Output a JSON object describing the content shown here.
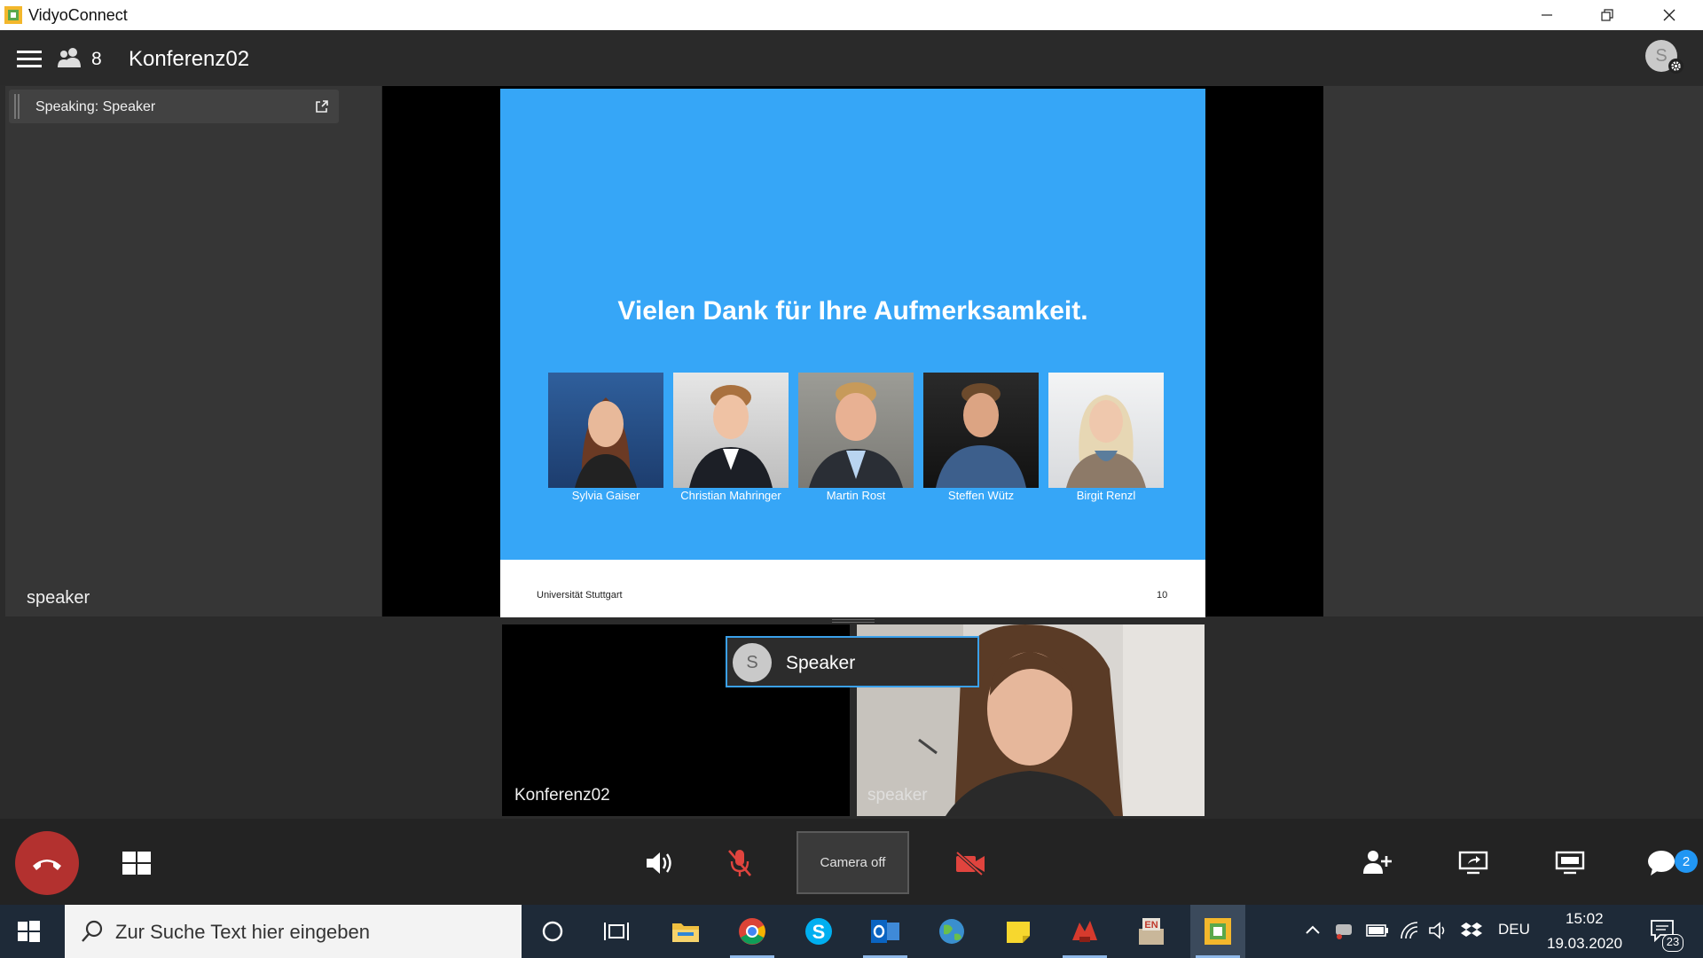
{
  "window": {
    "title": "VidyoConnect"
  },
  "header": {
    "participant_count": "8",
    "conference_name": "Konferenz02",
    "avatar_initial": "S"
  },
  "left_panel": {
    "speaking_label": "Speaking: Speaker",
    "speaker_name": "speaker"
  },
  "slide": {
    "title": "Vielen Dank für Ihre Aufmerksamkeit.",
    "people": [
      "Sylvia Gaiser",
      "Christian Mahringer",
      "Martin Rost",
      "Steffen Wütz",
      "Birgit Renzl"
    ],
    "footer_left": "Universität Stuttgart",
    "page_number": "10",
    "colors": {
      "background": "#36a6f7"
    }
  },
  "tiles": {
    "conference_label": "Konferenz02",
    "speaker_label": "speaker",
    "popup": {
      "initial": "S",
      "name": "Speaker"
    }
  },
  "controls": {
    "camera_label": "Camera off",
    "chat_badge": "2"
  },
  "taskbar": {
    "search_placeholder": "Zur Suche Text hier eingeben",
    "language": "DEU",
    "time": "15:02",
    "date": "19.03.2020",
    "notification_count": "23"
  },
  "icons": [
    "menu-icon",
    "participants-icon",
    "settings-icon",
    "popout-icon",
    "hangup-icon",
    "layout-icon",
    "speaker-icon",
    "mic-muted-icon",
    "camera-off-icon",
    "add-user-icon",
    "share-screen-icon",
    "monitor-icon",
    "chat-icon",
    "windows-start-icon",
    "search-icon",
    "cortana-icon",
    "task-view-icon"
  ],
  "colors": {
    "accent": "#3aa0ea",
    "hangup": "#b3312f",
    "muted": "#e0443e"
  }
}
